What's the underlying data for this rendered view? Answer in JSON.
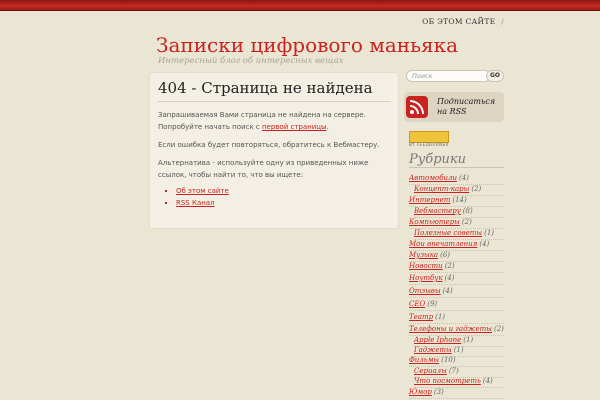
{
  "top_nav": {
    "about": "ОБ ЭТОМ САЙТЕ",
    "sep": "/"
  },
  "site": {
    "title": "Записки цифрового маньяка",
    "tagline": "Интересный блог об интересных вещах"
  },
  "page": {
    "title": "404 - Страница не найдена",
    "p1_before": "Запрашиваемая Вами страница не найдена на сервере. Попробуйте начать поиск с",
    "p1_link": "первой страницы",
    "p1_after": ".",
    "p2": "Если ошибка будет повторяться, обратитесь к Вебмастеру.",
    "p3": "Альтернатива - используйте одну из приведенных ниже ссылок, чтобы найти то, что вы ищете:",
    "links": [
      "Об этом сайте",
      "RSS Канал"
    ]
  },
  "search": {
    "placeholder": "Поиск",
    "button": "GO"
  },
  "rss": {
    "label": "Подписаться на RSS"
  },
  "feedburner": {
    "caption": "BY FEEDBURNER"
  },
  "sidebar": {
    "heading": "Рубрики",
    "categories": [
      {
        "name": "Автомобили",
        "count": "(4)"
      },
      {
        "name": "Концепт-кары",
        "count": "(2)"
      },
      {
        "name": "Интернет",
        "count": "(14)"
      },
      {
        "name": "Вебмастеру",
        "count": "(8)"
      },
      {
        "name": "Компьютеры",
        "count": "(2)"
      },
      {
        "name": "Полезные советы",
        "count": "(1)"
      },
      {
        "name": "Мои впечатления",
        "count": "(4)"
      },
      {
        "name": "Музыка",
        "count": "(6)"
      },
      {
        "name": "Новости",
        "count": "(2)"
      },
      {
        "name": "Ноутбук",
        "count": "(4)"
      },
      {
        "name": "Отзывы",
        "count": "(4)"
      },
      {
        "name": "СЕО",
        "count": "(9)"
      },
      {
        "name": "Театр",
        "count": "(1)"
      },
      {
        "name": "Телефоны и гаджеты",
        "count": "(2)"
      },
      {
        "name": "Apple Iphone",
        "count": "(1)"
      },
      {
        "name": "Гаджеты",
        "count": "(1)"
      },
      {
        "name": "Фильмы",
        "count": "(10)"
      },
      {
        "name": "Сериалы",
        "count": "(7)"
      },
      {
        "name": "Что посмотреть",
        "count": "(4)"
      },
      {
        "name": "Юмор",
        "count": "(3)"
      }
    ]
  },
  "colors": {
    "accent": "#c8231e",
    "background": "#ebe5d3",
    "content_bg": "#f3efe4"
  }
}
